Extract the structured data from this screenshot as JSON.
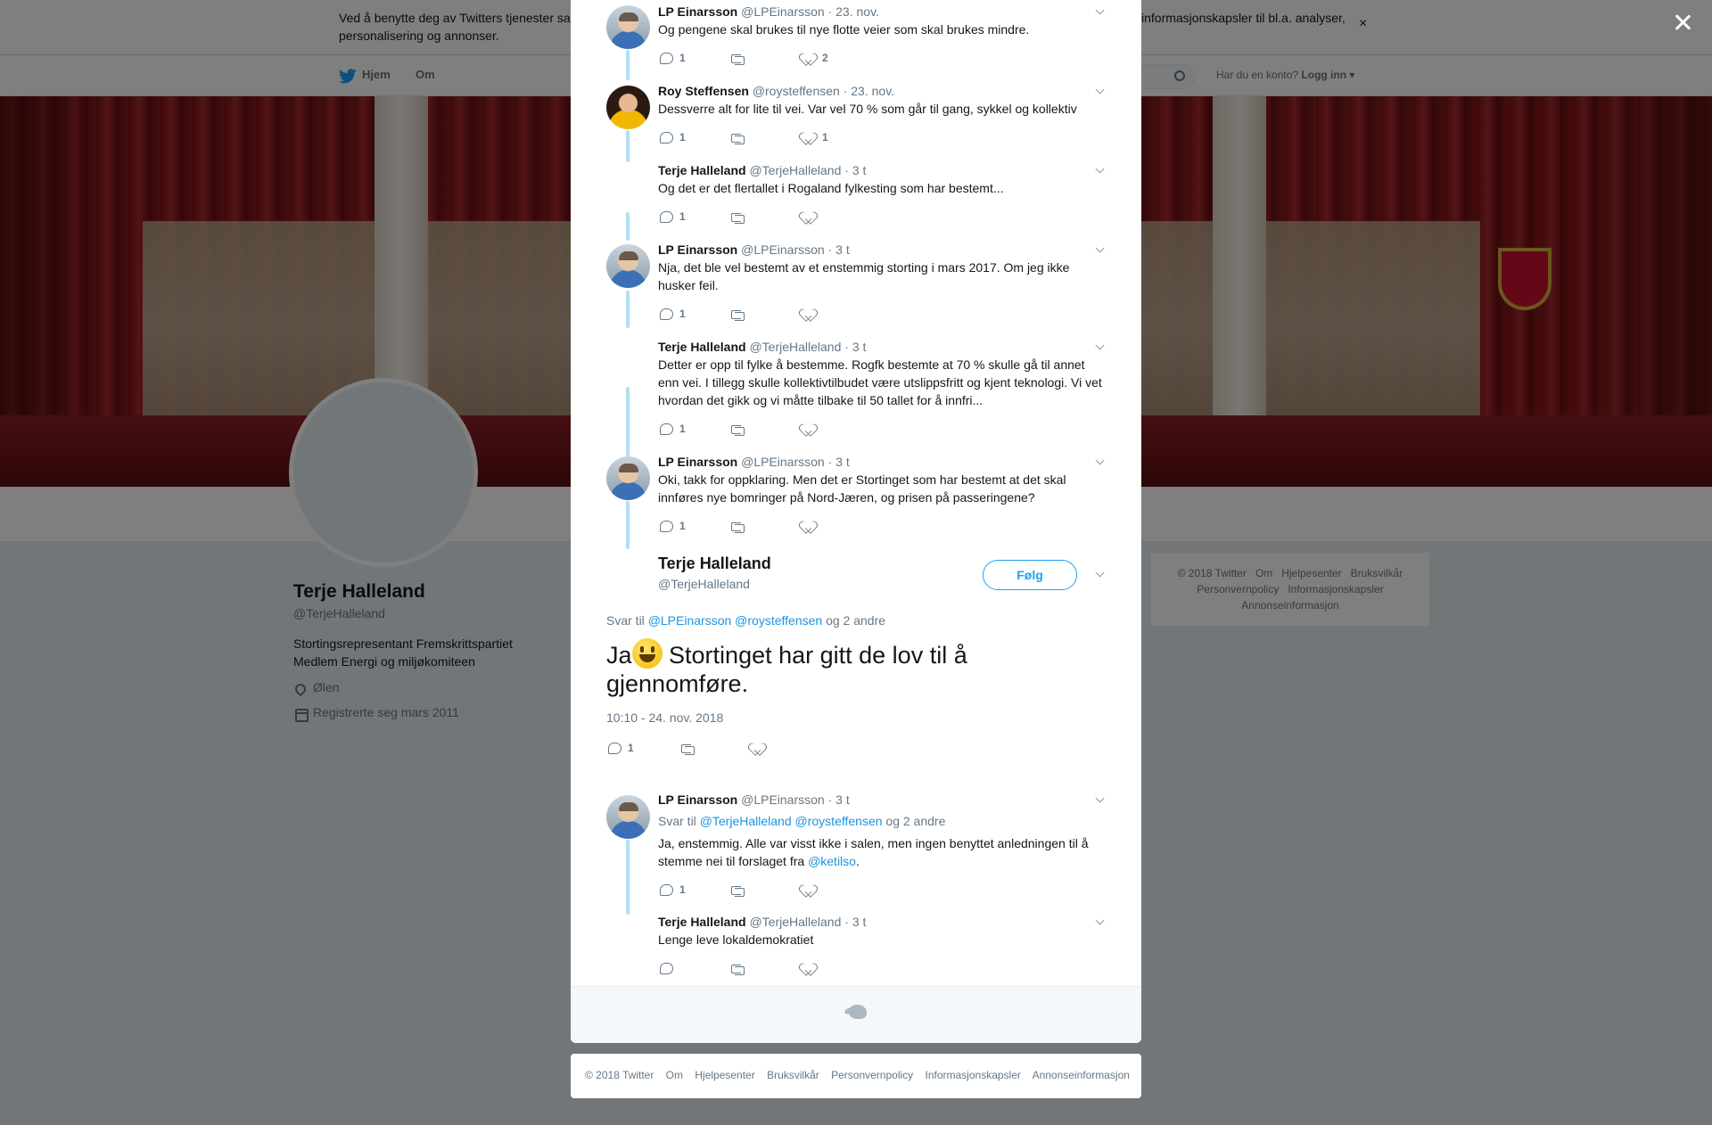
{
  "cookie_banner": {
    "text_left": "Ved å benytte deg av Twitters tjenester sa",
    "text_left_line2": "personalisering og annonser.",
    "text_right": "informasjonskapsler til bl.a. analyser,",
    "close": "×"
  },
  "topnav": {
    "home": "Hjem",
    "about": "Om",
    "login_prompt": "Har du en konto?",
    "login": "Logg inn"
  },
  "profile": {
    "name": "Terje Halleland",
    "handle": "@TerjeHalleland",
    "bio_line1": "Stortingsrepresentant Fremskrittspartiet",
    "bio_line2": "Medlem Energi og miljøkomiteen",
    "location": "Ølen",
    "joined": "Registrerte seg mars 2011"
  },
  "side_footer": {
    "items": [
      "© 2018 Twitter",
      "Om",
      "Hjelpesenter",
      "Bruksvilkår",
      "Personvernpolicy",
      "Informasjonskapsler",
      "Annonseinformasjon"
    ]
  },
  "thread": [
    {
      "name": "LP Einarsson",
      "handle": "@LPEinarsson",
      "time": "· 23. nov.",
      "text": "Og pengene skal brukes til nye flotte veier som skal brukes mindre.",
      "replies": "1",
      "retweets": "",
      "likes": "2"
    },
    {
      "name": "Roy Steffensen",
      "handle": "@roysteffensen",
      "time": "· 23. nov.",
      "text": "Dessverre alt for lite til vei. Var vel 70 % som går til gang, sykkel og kollektiv",
      "replies": "1",
      "retweets": "",
      "likes": "1"
    },
    {
      "name": "Terje Halleland",
      "handle": "@TerjeHalleland",
      "time": "· 3 t",
      "text": "Og det er det flertallet i Rogaland fylkesting som har bestemt...",
      "replies": "1",
      "retweets": "",
      "likes": ""
    },
    {
      "name": "LP Einarsson",
      "handle": "@LPEinarsson",
      "time": "· 3 t",
      "text": "Nja, det ble vel bestemt av et enstemmig storting i mars 2017. Om jeg ikke husker feil.",
      "replies": "1",
      "retweets": "",
      "likes": ""
    },
    {
      "name": "Terje Halleland",
      "handle": "@TerjeHalleland",
      "time": "· 3 t",
      "text": "Detter er opp til fylke å bestemme. Rogfk bestemte at 70 % skulle gå til annet enn vei. I tillegg skulle kollektivtilbudet være utslippsfritt og kjent teknologi. Vi vet hvordan det gikk og vi måtte tilbake til 50 tallet for å innfri...",
      "replies": "1",
      "retweets": "",
      "likes": ""
    },
    {
      "name": "LP Einarsson",
      "handle": "@LPEinarsson",
      "time": "· 3 t",
      "text": "Oki, takk for oppklaring. Men det er Stortinget som har bestemt at det skal innføres nye bomringer på Nord-Jæren, og prisen på passeringene?",
      "replies": "1",
      "retweets": "",
      "likes": ""
    }
  ],
  "main_tweet": {
    "name": "Terje Halleland",
    "handle": "@TerjeHalleland",
    "follow": "Følg",
    "reply_prefix": "Svar til",
    "reply_user1": "@LPEinarsson",
    "reply_user2": "@roysteffensen",
    "reply_suffix": "og 2 andre",
    "text_before_emoji": "Ja",
    "text_after_emoji": " Stortinget har gitt de lov til å gjennomføre.",
    "timestamp": "10:10 - 24. nov. 2018",
    "replies": "1"
  },
  "replies": [
    {
      "name": "LP Einarsson",
      "handle": "@LPEinarsson",
      "time": "· 3 t",
      "reply_prefix": "Svar til",
      "reply_user1": "@TerjeHalleland",
      "reply_user2": "@roysteffensen",
      "reply_suffix": "og 2 andre",
      "text": "Ja, enstemmig. Alle var visst ikke i salen, men ingen benyttet anledningen til å stemme nei til forslaget fra ",
      "mention": "@ketilso",
      "text_end": ".",
      "replies": "1"
    },
    {
      "name": "Terje Halleland",
      "handle": "@TerjeHalleland",
      "time": "· 3 t",
      "text": "Lenge leve lokaldemokratiet",
      "replies": ""
    }
  ],
  "bottom_footer": {
    "items": [
      "© 2018 Twitter",
      "Om",
      "Hjelpesenter",
      "Bruksvilkår",
      "Personvernpolicy",
      "Informasjonskapsler",
      "Annonseinformasjon"
    ]
  }
}
